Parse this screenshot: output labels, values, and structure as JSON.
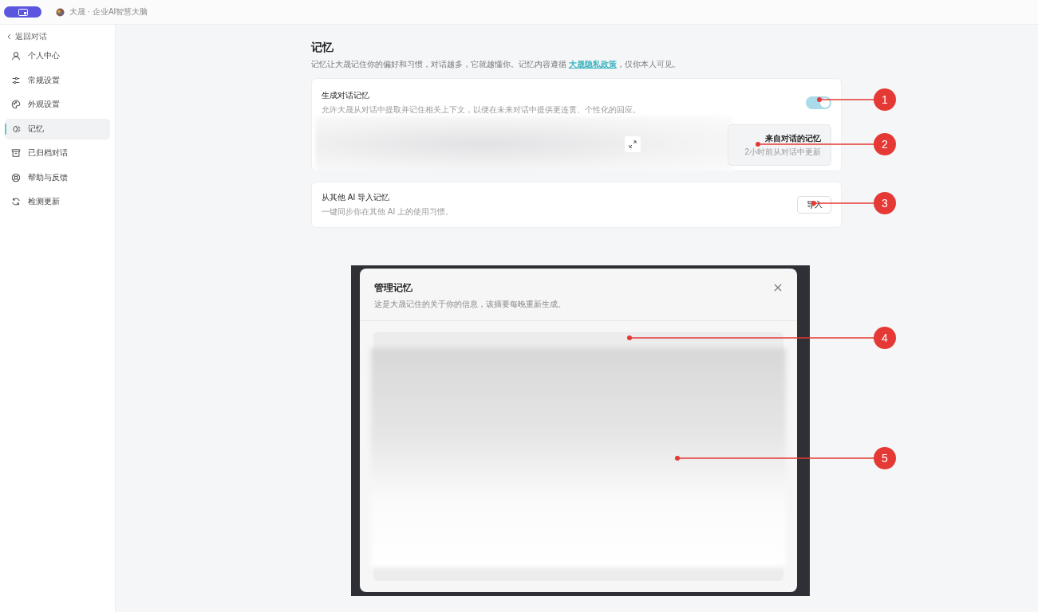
{
  "app_bar": {
    "title": "大晟 · 企业AI智慧大脑"
  },
  "sidebar": {
    "back": "返回对话",
    "items": [
      {
        "label": "个人中心",
        "kind": "person",
        "selected": false
      },
      {
        "label": "常规设置",
        "kind": "sliders",
        "selected": false
      },
      {
        "label": "外观设置",
        "kind": "palette",
        "selected": false
      },
      {
        "label": "记忆",
        "kind": "memory",
        "selected": true
      },
      {
        "label": "已归档对话",
        "kind": "archive",
        "selected": false
      },
      {
        "label": "帮助与反馈",
        "kind": "help",
        "selected": false
      },
      {
        "label": "检测更新",
        "kind": "refresh",
        "selected": false
      }
    ]
  },
  "page": {
    "title": "记忆",
    "description_prefix": "记忆让大晟记住你的偏好和习惯，对话越多，它就越懂你。记忆内容遵循 ",
    "link": "大晟隐私政策",
    "description_suffix": "，仅你本人可见。"
  },
  "generate_card": {
    "title": "生成对话记忆",
    "description": "允许大晟从对话中提取并记住相关上下文，以便在未来对话中提供更连贯、个性化的回应。",
    "on": true,
    "source": {
      "title": "来自对话的记忆",
      "subtitle": "2小时前从对话中更新"
    }
  },
  "import_card": {
    "title": "从其他 AI 导入记忆",
    "description": "一键同步你在其他 AI 上的使用习惯。",
    "button": "导入"
  },
  "modal": {
    "title": "管理记忆",
    "subtitle": "这是大晟记住的关于你的信息，该摘要每晚重新生成。"
  },
  "callouts": [
    {
      "number": "1"
    },
    {
      "number": "2"
    },
    {
      "number": "3"
    },
    {
      "number": "4"
    },
    {
      "number": "5"
    }
  ]
}
